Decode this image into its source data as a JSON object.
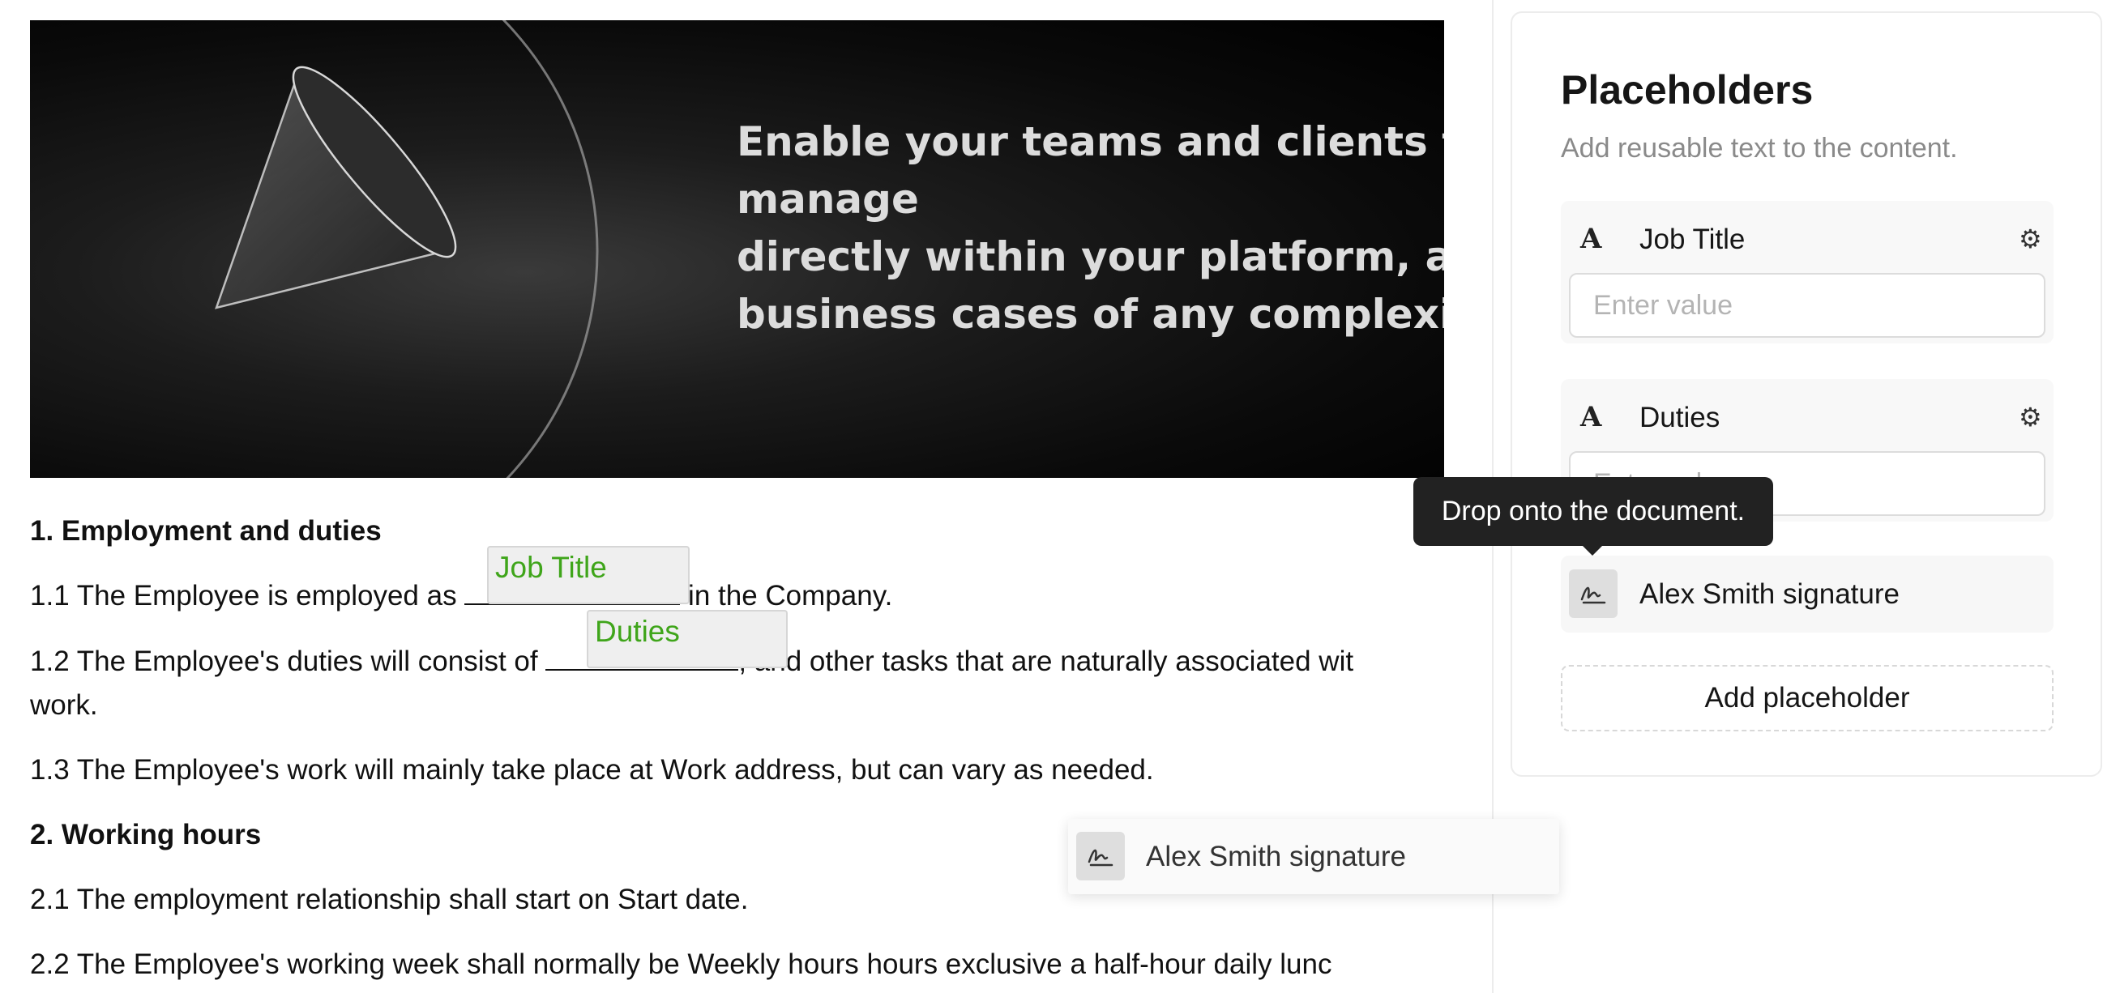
{
  "banner": {
    "text": "Enable your teams and clients to manage\ndirectly within your platform, accor\nbusiness cases of any complexity."
  },
  "document": {
    "section1_heading": "1. Employment and duties",
    "p1_1_before": "1.1 The Employee is employed as ",
    "p1_1_after": " in the Company.",
    "p1_2_before": "1.2 The Employee's duties will consist of ",
    "p1_2_after": ", and other tasks that are naturally associated wit",
    "p1_2_cont": "work.",
    "p1_3": "1.3 The Employee's work will mainly take place at Work address, but can vary as needed.",
    "section2_heading": "2. Working hours",
    "p2_1": "2.1 The employment relationship shall start on Start date.",
    "p2_2": "2.2 The Employee's working week shall normally be Weekly hours hours exclusive a half-hour daily lunc",
    "chips": {
      "job_title": "Job Title",
      "duties": "Duties"
    }
  },
  "panel": {
    "title": "Placeholders",
    "subtitle": "Add reusable text to the content.",
    "placeholders": [
      {
        "icon": "text-icon",
        "label": "Job Title",
        "placeholder": "Enter value"
      },
      {
        "icon": "text-icon",
        "label": "Duties",
        "placeholder": "Enter value"
      }
    ],
    "signature": {
      "icon": "signature-icon",
      "label": "Alex Smith signature"
    },
    "add_button": "Add placeholder"
  },
  "tooltip": {
    "text": "Drop onto the document."
  },
  "drag_ghost": {
    "icon": "signature-icon",
    "label": "Alex Smith signature"
  },
  "colors": {
    "placeholder_chip_text": "#3fa51a",
    "tooltip_bg": "#222222"
  }
}
